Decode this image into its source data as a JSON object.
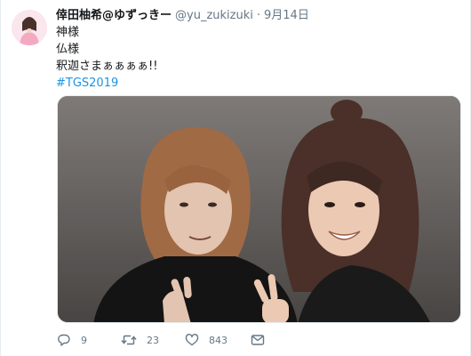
{
  "tweet": {
    "display_name": "倖田柚希@ゆずっきー",
    "handle": "@yu_zukizuki",
    "separator": "·",
    "date": "9月14日",
    "text_lines": [
      "神様",
      "仏様",
      "釈迦さまぁぁぁぁ!!"
    ],
    "hashtag": "#TGS2019",
    "media_description_icon": "photo",
    "avatar_icon": "profile-avatar"
  },
  "actions": {
    "reply_count": "9",
    "retweet_count": "23",
    "like_count": "843",
    "icons": [
      "reply-icon",
      "retweet-icon",
      "like-icon",
      "direct-message-icon"
    ]
  },
  "colors": {
    "text": "#14171a",
    "muted": "#657786",
    "link": "#1b95e0",
    "border": "#e6ecf0"
  }
}
